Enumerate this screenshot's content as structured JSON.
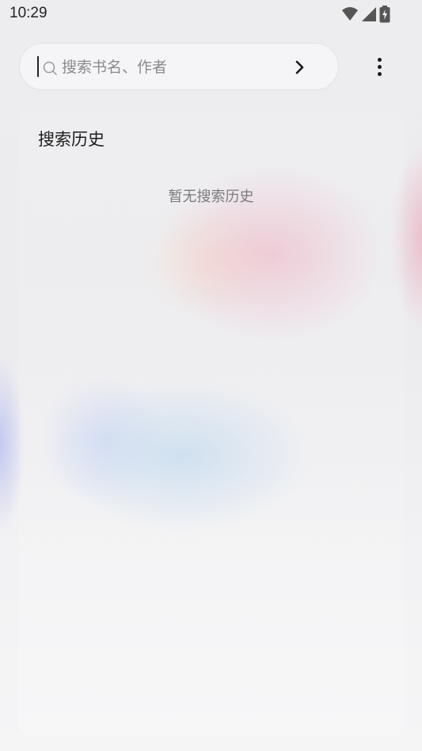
{
  "status_bar": {
    "time": "10:29",
    "icons": [
      "wifi-icon",
      "cell-signal-icon",
      "battery-charging-icon"
    ]
  },
  "search": {
    "placeholder": "搜索书名、作者",
    "value": "",
    "icon": "search-icon",
    "submit_icon": "chevron-right-icon"
  },
  "menu": {
    "icon": "more-vertical-icon"
  },
  "history": {
    "title": "搜索历史",
    "empty_text": "暂无搜索历史"
  }
}
